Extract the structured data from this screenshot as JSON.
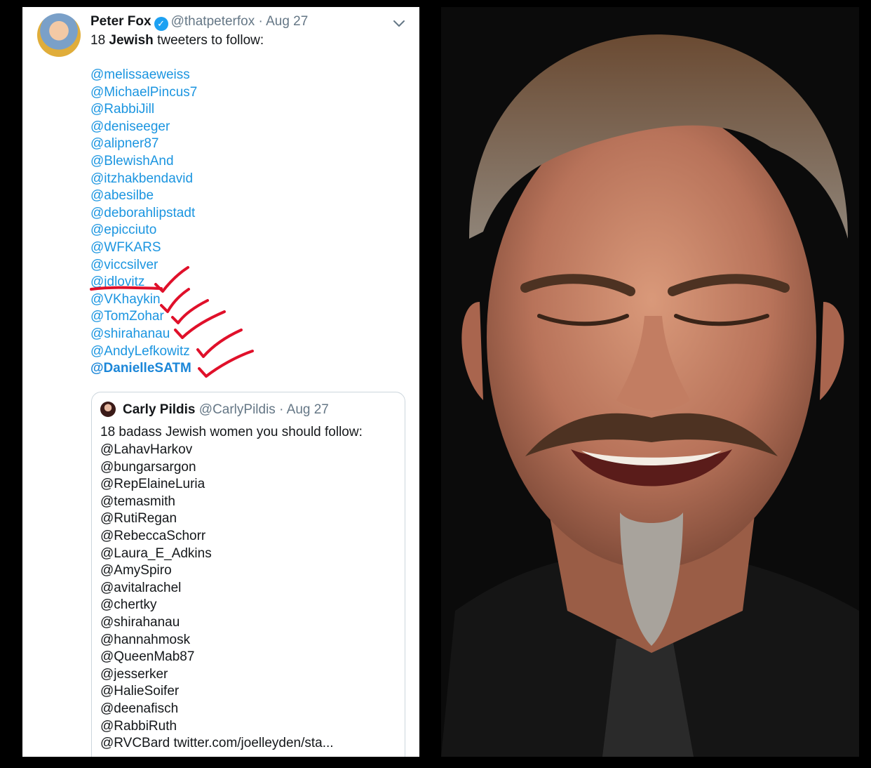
{
  "tweet": {
    "author_name": "Peter Fox",
    "author_handle": "@thatpeterfox",
    "separator": "·",
    "date": "Aug 27",
    "text_prefix": "18 ",
    "text_bold": "Jewish",
    "text_suffix": " tweeters to follow:",
    "mentions": [
      "@melissaeweiss",
      "@MichaelPincus7",
      "@RabbiJill",
      "@deniseeger",
      "@alipner87",
      "@BlewishAnd",
      "@itzhakbendavid",
      "@abesilbe",
      "@deborahlipstadt",
      "@epicciuto",
      "@WFKARS",
      "@viccsilver",
      "@jdlovitz",
      "@VKhaykin",
      "@TomZohar",
      "@shirahanau",
      "@AndyLefkowitz",
      "@DanielleSATM"
    ],
    "verified_icon": "verified-check-icon",
    "menu_icon": "chevron-down-icon",
    "link_color": "#1b95e0",
    "annotation_color": "#e0102a"
  },
  "quote": {
    "author_name": "Carly Pildis",
    "author_handle": "@CarlyPildis",
    "separator": "·",
    "date": "Aug 27",
    "text": "18 badass Jewish women you should follow:",
    "mentions": [
      "@LahavHarkov",
      "@bungarsargon",
      "@RepElaineLuria",
      "@temasmith",
      "@RutiRegan",
      "@RebeccaSchorr",
      "@Laura_E_Adkins",
      "@AmySpiro",
      "@avitalrachel",
      "@chertky",
      "@shirahanau",
      "@hannahmosk",
      "@QueenMab87",
      "@jesserker",
      "@HalieSoifer",
      "@deenafisch",
      "@RabbiRuth",
      "@RVCBard twitter.com/joelleyden/sta..."
    ]
  },
  "photo": {
    "subject": "laughing-man-photo"
  }
}
